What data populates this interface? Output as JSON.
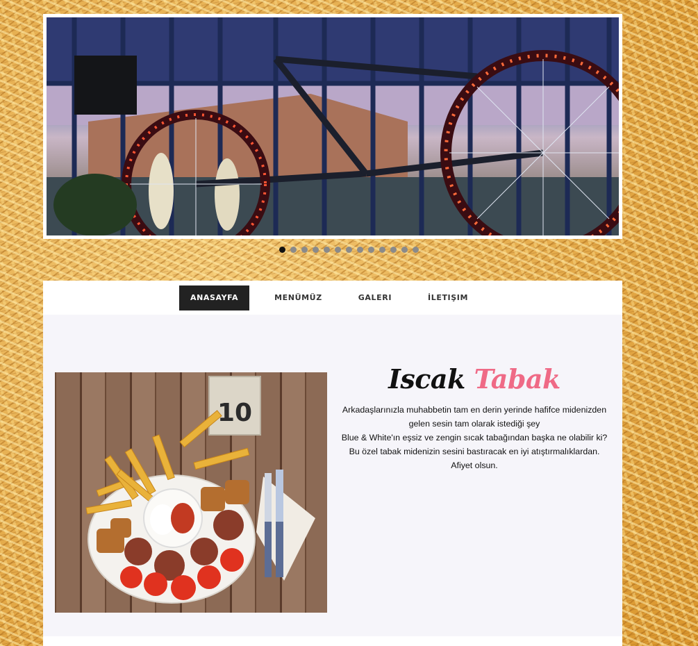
{
  "slider": {
    "image_alt": "bicycle-with-lights",
    "dot_count": 13,
    "active_index": 0
  },
  "nav": {
    "items": [
      {
        "label": "ANASAYFA"
      },
      {
        "label": "MENÜMÜZ"
      },
      {
        "label": "GALERI"
      },
      {
        "label": "İLETIŞIM"
      }
    ]
  },
  "main": {
    "title_part1": "Iscak",
    "title_part2": "Tabak",
    "paragraph1": "Arkadaşlarınızla muhabbetin tam en derin yerinde hafifce midenizden gelen sesin tam olarak istediği şey",
    "paragraph2": "Blue & White'ın eşsiz ve zengin sıcak tabağından başka ne olabilir ki? Bu özel tabak midenizin sesini bastıracak en iyi atıştırmalıklardan. Afiyet olsun.",
    "table_number": "10"
  },
  "colors": {
    "accent_pink": "#ef6a86",
    "nav_active_bg": "#222222",
    "background": "#e0a83c"
  }
}
